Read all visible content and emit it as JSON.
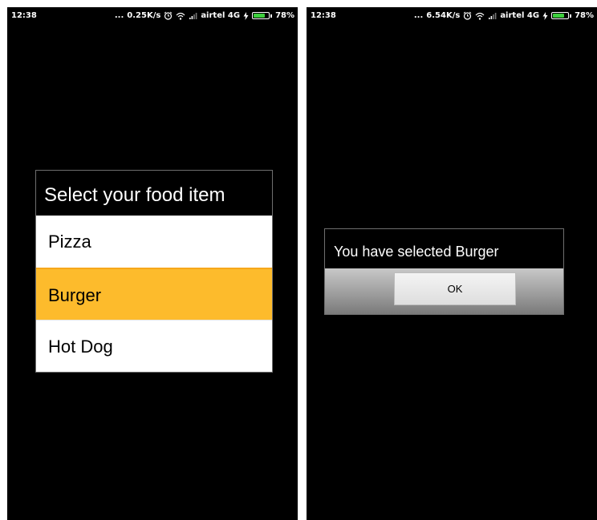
{
  "screens": [
    {
      "status": {
        "time": "12:38",
        "dots": "...",
        "speed": "0.25K/s",
        "carrier": "airtel 4G",
        "battery": "78%",
        "battery_level": 0.78
      },
      "dialog": {
        "title": "Select your food item",
        "options": [
          "Pizza",
          "Burger",
          "Hot Dog"
        ],
        "selected_index": 1
      }
    },
    {
      "status": {
        "time": "12:38",
        "dots": "...",
        "speed": "6.54K/s",
        "carrier": "airtel 4G",
        "battery": "78%",
        "battery_level": 0.78
      },
      "dialog": {
        "message": "You have selected Burger",
        "ok_label": "OK"
      }
    }
  ],
  "colors": {
    "selected_highlight": "#fdbb2c",
    "battery_green": "#3ecf3e"
  },
  "icons": [
    "alarm-icon",
    "wifi-icon",
    "signal-icon",
    "charging-icon",
    "battery-icon"
  ]
}
